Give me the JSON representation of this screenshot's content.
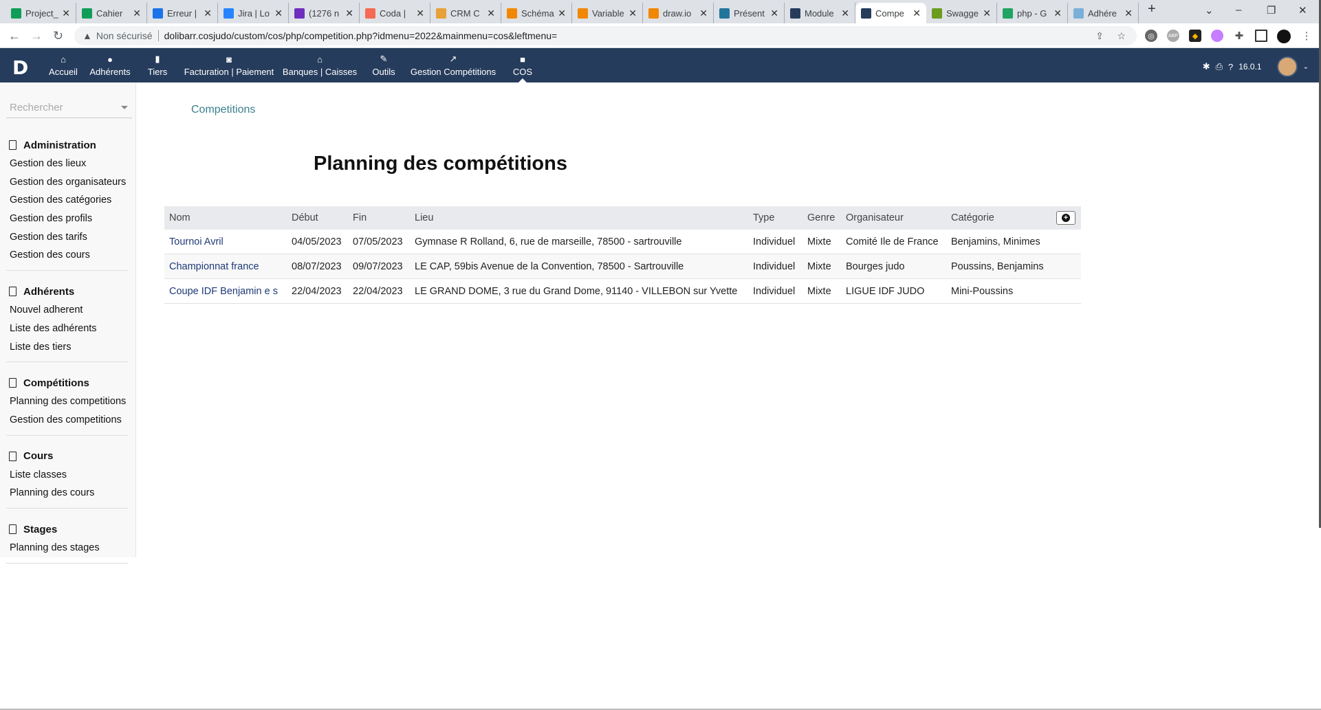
{
  "browser": {
    "tabs": [
      {
        "label": "Project_",
        "color": "#0f9d58"
      },
      {
        "label": "Cahier",
        "color": "#0f9d58"
      },
      {
        "label": "Erreur |",
        "color": "#1a73e8"
      },
      {
        "label": "Jira | Lo",
        "color": "#2684ff"
      },
      {
        "label": "(1276 n",
        "color": "#6f2dbd"
      },
      {
        "label": "Coda |",
        "color": "#f46a54"
      },
      {
        "label": "CRM C",
        "color": "#e8a13a"
      },
      {
        "label": "Schéma",
        "color": "#f08705"
      },
      {
        "label": "Variable",
        "color": "#f08705"
      },
      {
        "label": "draw.io",
        "color": "#f08705"
      },
      {
        "label": "Présent",
        "color": "#21759b"
      },
      {
        "label": "Module",
        "color": "#263c5c"
      },
      {
        "label": "Compe",
        "color": "#263c5c",
        "active": true
      },
      {
        "label": "Swagge",
        "color": "#6a9c1f"
      },
      {
        "label": "php - G",
        "color": "#1fa463"
      },
      {
        "label": "Adhére",
        "color": "#7ab0d8"
      }
    ],
    "new_tab": "+",
    "security": "Non sécurisé",
    "url": "dolibarr.cosjudo/custom/cos/php/competition.php?idmenu=2022&mainmenu=cos&leftmenu="
  },
  "topnav": {
    "logo": "D",
    "menu": [
      {
        "label": "Accueil",
        "icon": "home-icon",
        "glyph": "⌂"
      },
      {
        "label": "Adhérents",
        "icon": "user-icon",
        "glyph": "●"
      },
      {
        "label": "Tiers",
        "icon": "building-icon",
        "glyph": "▮"
      },
      {
        "label": "Facturation | Paiement",
        "icon": "coins-icon",
        "glyph": "◙"
      },
      {
        "label": "Banques | Caisses",
        "icon": "bank-icon",
        "glyph": "⌂"
      },
      {
        "label": "Outils",
        "icon": "wrench-icon",
        "glyph": "✎"
      },
      {
        "label": "Gestion Compétitions",
        "icon": "external-link-icon",
        "glyph": "↗"
      },
      {
        "label": "COS",
        "icon": "note-icon",
        "glyph": "■",
        "active": true
      }
    ],
    "version": "16.0.1"
  },
  "sidebar": {
    "search_placeholder": "Rechercher",
    "groups": [
      {
        "title": "Administration",
        "items": [
          "Gestion des lieux",
          "Gestion des organisateurs",
          "Gestion des catégories",
          "Gestion des profils",
          "Gestion des tarifs",
          "Gestion des cours"
        ]
      },
      {
        "title": "Adhérents",
        "items": [
          "Nouvel adherent",
          "Liste des adhérents",
          "Liste des tiers"
        ]
      },
      {
        "title": "Compétitions",
        "items": [
          "Planning des competitions",
          "Gestion des competitions"
        ]
      },
      {
        "title": "Cours",
        "items": [
          "Liste classes",
          "Planning des cours"
        ]
      },
      {
        "title": "Stages",
        "items": [
          "Planning des stages"
        ]
      }
    ]
  },
  "main": {
    "breadcrumb": "Competitions",
    "title": "Planning des compétitions",
    "table": {
      "columns": [
        "Nom",
        "Début",
        "Fin",
        "Lieu",
        "Type",
        "Genre",
        "Organisateur",
        "Catégorie"
      ],
      "rows": [
        [
          "Tournoi Avril",
          "04/05/2023",
          "07/05/2023",
          "Gymnase R Rolland, 6, rue de marseille, 78500 - sartrouville",
          "Individuel",
          "Mixte",
          "Comité Ile de France",
          "Benjamins, Minimes"
        ],
        [
          "Championnat france",
          "08/07/2023",
          "09/07/2023",
          "LE CAP, 59bis Avenue de la Convention, 78500 - Sartrouville",
          "Individuel",
          "Mixte",
          "Bourges judo",
          "Poussins, Benjamins"
        ],
        [
          "Coupe IDF Benjamin e s",
          "22/04/2023",
          "22/04/2023",
          "LE GRAND DOME, 3 rue du Grand Dome, 91140 - VILLEBON sur Yvette",
          "Individuel",
          "Mixte",
          "LIGUE IDF JUDO",
          "Mini-Poussins"
        ]
      ]
    }
  }
}
